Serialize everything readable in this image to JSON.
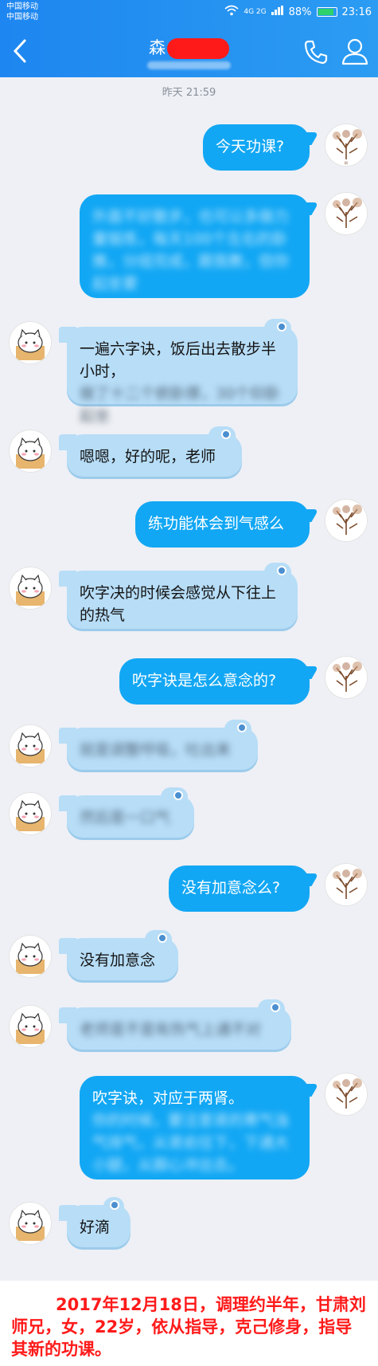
{
  "status_bar": {
    "carrier_1": "中国移动",
    "carrier_2": "中国移动",
    "network": "4G 2G",
    "battery": "88%",
    "time": "23:16"
  },
  "header": {
    "title": "森",
    "back_icon": "chevron-left-icon",
    "call_icon": "phone-icon",
    "profile_icon": "person-icon"
  },
  "timestamp": "昨天 21:59",
  "messages": [
    {
      "side": "out",
      "text": "今天功课?"
    },
    {
      "side": "out",
      "text": "外面不好散步，也可以多做力量锻炼，每天100个左右的卧推，分组完成，跟我教，但你起坐要",
      "blurred": true
    },
    {
      "side": "in",
      "text_1": "一遍六字诀，饭后出去散步半小时，",
      "text_2": "做了十二个俯卧撑，30个仰卧起坐",
      "blurred_part": true
    },
    {
      "side": "in",
      "text": "嗯嗯，好的呢，老师"
    },
    {
      "side": "out",
      "text": "练功能体会到气感么"
    },
    {
      "side": "in",
      "text": "吹字决的时候会感觉从下往上的热气"
    },
    {
      "side": "out",
      "text": "吹字诀是怎么意念的?"
    },
    {
      "side": "in",
      "text": "就是调整呼吸，吐出来",
      "blurred": true
    },
    {
      "side": "in",
      "text": "然后是一口气",
      "blurred": true
    },
    {
      "side": "out",
      "text": "没有加意念么?"
    },
    {
      "side": "in",
      "text": "没有加意念"
    },
    {
      "side": "in",
      "text": "老师是不是有热气上通不对",
      "blurred": true
    },
    {
      "side": "out",
      "text_1": "吹字诀，对应于两肾。",
      "text_2": "你的时候，要注意肾的寒气浊气排气，从肾俞往下，下通大小腿，从脚心冲出去。",
      "blurred_part": true
    },
    {
      "side": "in",
      "text": "好滴"
    }
  ],
  "caption": "2017年12月18日，调理约半年，甘肃刘师兄，女，22岁，依从指导，克己修身，指导其新的功课。"
}
